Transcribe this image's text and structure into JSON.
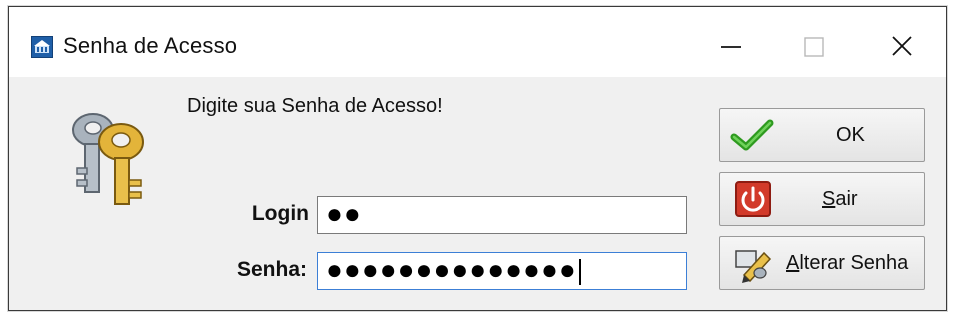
{
  "window": {
    "title": "Senha de Acesso"
  },
  "dialog": {
    "prompt": "Digite sua Senha de Acesso!",
    "login_label": "Login",
    "login_value": "●●",
    "senha_label": "Senha:",
    "senha_value": "●●●●●●●●●●●●●●"
  },
  "buttons": {
    "ok": "OK",
    "sair_mnemonic": "S",
    "sair_rest": "air",
    "alterar_mnemonic": "A",
    "alterar_rest": "lterar Senha"
  },
  "icons": {
    "app": "app-logo-icon",
    "keys": "keys-icon",
    "ok": "checkmark-icon",
    "sair": "power-icon",
    "alterar": "pen-key-icon"
  },
  "colors": {
    "accent": "#3c7fd6",
    "ok_green": "#2e9a1f",
    "sair_red": "#d23a2a"
  }
}
